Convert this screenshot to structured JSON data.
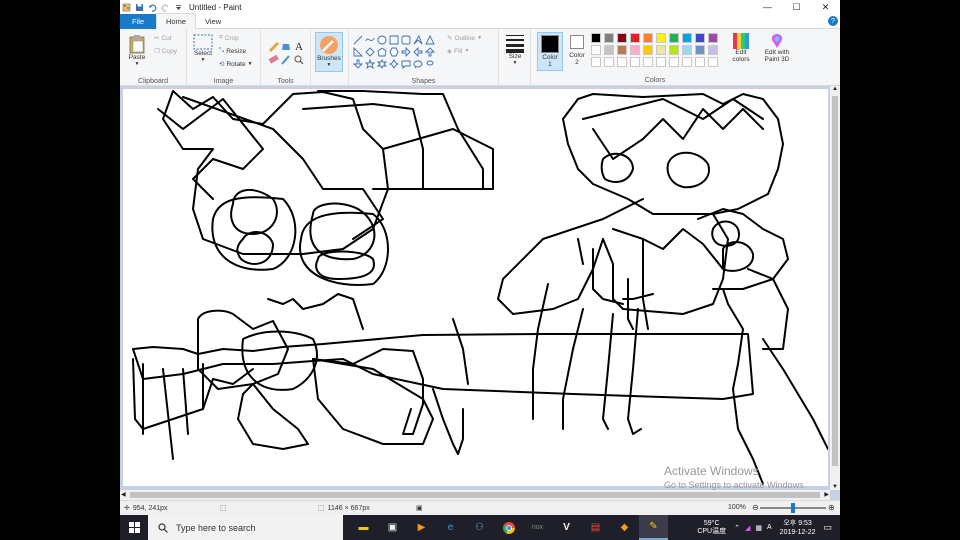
{
  "window": {
    "title": "Untitled - Paint",
    "minimize": "—",
    "maximize": "☐",
    "close": "✕"
  },
  "tabs": {
    "file": "File",
    "home": "Home",
    "view": "View"
  },
  "ribbon": {
    "clipboard": {
      "label": "Clipboard",
      "paste": "Paste",
      "cut": "Cut",
      "copy": "Copy"
    },
    "image": {
      "label": "Image",
      "select": "Select",
      "crop": "Crop",
      "resize": "Resize",
      "rotate": "Rotate"
    },
    "tools": {
      "label": "Tools"
    },
    "brushes": {
      "label": "Brushes"
    },
    "shapes": {
      "label": "Shapes",
      "outline": "Outline",
      "fill": "Fill"
    },
    "size": {
      "label": "Size"
    },
    "color1": {
      "label": "Color\n1",
      "value": "#000000"
    },
    "color2": {
      "label": "Color\n2",
      "value": "#ffffff"
    },
    "colors": {
      "label": "Colors",
      "row1": [
        "#000000",
        "#7f7f7f",
        "#880015",
        "#ed1c24",
        "#ff7f27",
        "#fff200",
        "#22b14c",
        "#00a2e8",
        "#3f48cc",
        "#a349a4"
      ],
      "row2": [
        "#ffffff",
        "#c3c3c3",
        "#b97a57",
        "#ffaec9",
        "#ffc90e",
        "#efe4b0",
        "#b5e61d",
        "#99d9ea",
        "#7092be",
        "#c8bfe7"
      ]
    },
    "edit_colors": "Edit\ncolors",
    "edit_paint3d": "Edit with\nPaint 3D"
  },
  "watermark": {
    "line1": "Activate Windows",
    "line2": "Go to Settings to activate Windows."
  },
  "status": {
    "cursor_pos": "954, 241px",
    "image_size": "1146 × 667px",
    "zoom": "100%",
    "zoom_level": 0.5
  },
  "taskbar": {
    "search_placeholder": "Type here to search",
    "temp": "59°C",
    "cpu": "CPU温度",
    "ime": "오후",
    "time": "9:53",
    "date": "2019-12-22",
    "ime_mode": "A"
  }
}
